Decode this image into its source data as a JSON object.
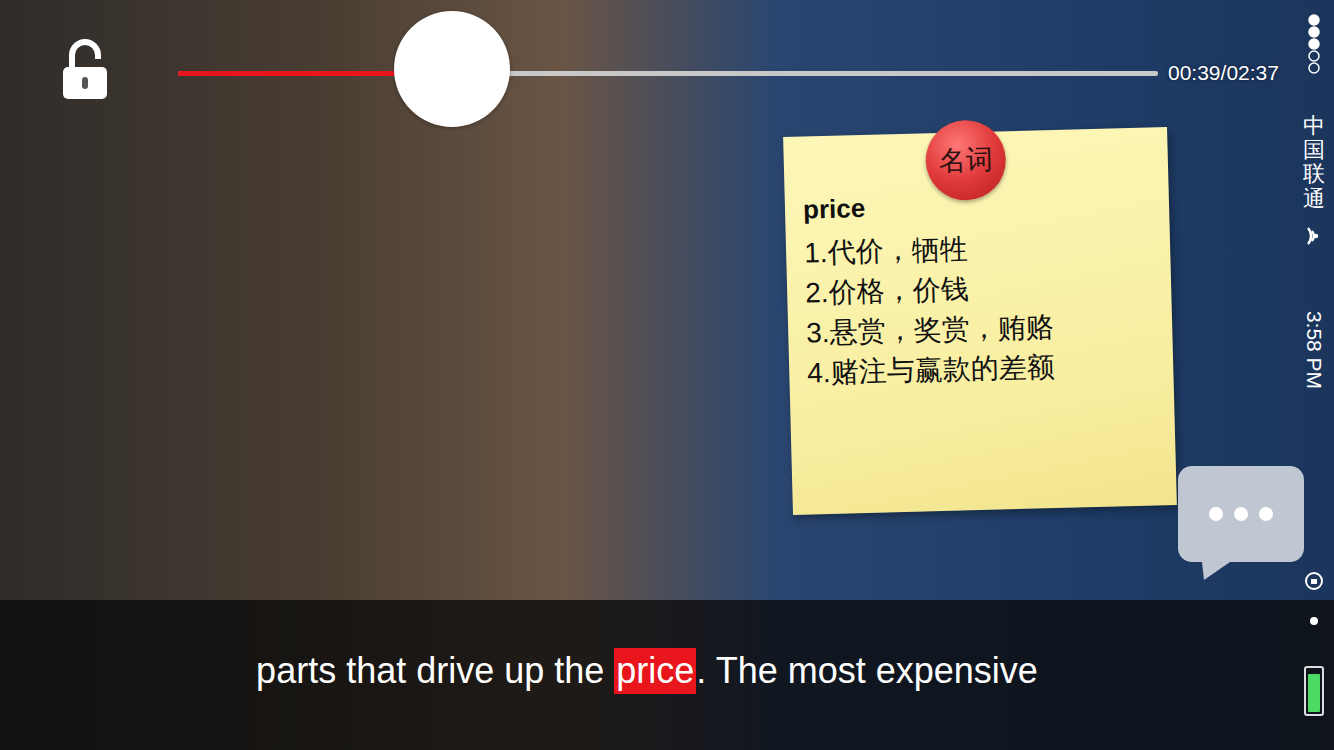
{
  "player": {
    "locked": false,
    "progress": {
      "level": 0.28,
      "time": "00:39/02:37"
    }
  },
  "status_bar": {
    "carrier": "中国联通",
    "time": "3:58 PM",
    "battery_level": 0.9
  },
  "dictionary": {
    "part_of_speech": "名词",
    "word": "price",
    "definitions": [
      "1.代价，牺牲",
      "2.价格，价钱",
      "3.悬赏，奖赏，贿赂",
      "4.赌注与赢款的差额"
    ]
  },
  "subtitle": {
    "segments": [
      {
        "text": "parts that drive up the ",
        "highlighted": false
      },
      {
        "text": "price",
        "highlighted": true
      },
      {
        "text": ". The most expensive",
        "highlighted": false
      }
    ]
  }
}
